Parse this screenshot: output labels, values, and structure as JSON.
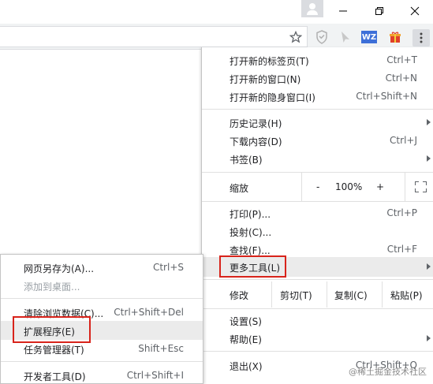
{
  "window": {
    "avatar_icon": "person-icon",
    "minimize_icon": "minimize-icon",
    "maximize_icon": "restore-icon",
    "close_icon": "close-icon"
  },
  "toolbar": {
    "bookmark_icon": "star-icon",
    "extensions": [
      "shield-icon",
      "arrow-icon",
      "wz-icon",
      "gift-icon"
    ],
    "wz_label": "WZ",
    "menu_icon": "kebab-icon"
  },
  "main_menu": {
    "items": [
      {
        "label": "打开新的标签页(T)",
        "shortcut": "Ctrl+T"
      },
      {
        "label": "打开新的窗口(N)",
        "shortcut": "Ctrl+N"
      },
      {
        "label": "打开新的隐身窗口(I)",
        "shortcut": "Ctrl+Shift+N"
      },
      {
        "label": "历史记录(H)",
        "shortcut": ""
      },
      {
        "label": "下载内容(D)",
        "shortcut": "Ctrl+J"
      },
      {
        "label": "书签(B)",
        "shortcut": ""
      },
      {
        "label": "打印(P)...",
        "shortcut": "Ctrl+P"
      },
      {
        "label": "投射(C)...",
        "shortcut": ""
      },
      {
        "label": "查找(F)...",
        "shortcut": "Ctrl+F"
      },
      {
        "label": "更多工具(L)",
        "shortcut": ""
      },
      {
        "label": "设置(S)",
        "shortcut": ""
      },
      {
        "label": "帮助(E)",
        "shortcut": ""
      },
      {
        "label": "退出(X)",
        "shortcut": "Ctrl+Shift+Q"
      }
    ],
    "zoom": {
      "label": "缩放",
      "minus": "-",
      "value": "100%",
      "plus": "+"
    },
    "edit": {
      "label": "修改",
      "cut": "剪切(T)",
      "copy": "复制(C)",
      "paste": "粘贴(P)"
    }
  },
  "sub_menu": {
    "items": [
      {
        "label": "网页另存为(A)...",
        "shortcut": "Ctrl+S"
      },
      {
        "label": "添加到桌面...",
        "shortcut": ""
      },
      {
        "label": "清除浏览数据(C)...",
        "shortcut": "Ctrl+Shift+Del"
      },
      {
        "label": "扩展程序(E)",
        "shortcut": ""
      },
      {
        "label": "任务管理器(T)",
        "shortcut": "Shift+Esc"
      },
      {
        "label": "开发者工具(D)",
        "shortcut": "Ctrl+Shift+I"
      }
    ]
  },
  "watermark": "@稀土掘金技术社区",
  "colors": {
    "highlight_box": "#d8231b",
    "menu_hover": "#ebebeb",
    "toolbar_bg": "#f1f3f4"
  }
}
